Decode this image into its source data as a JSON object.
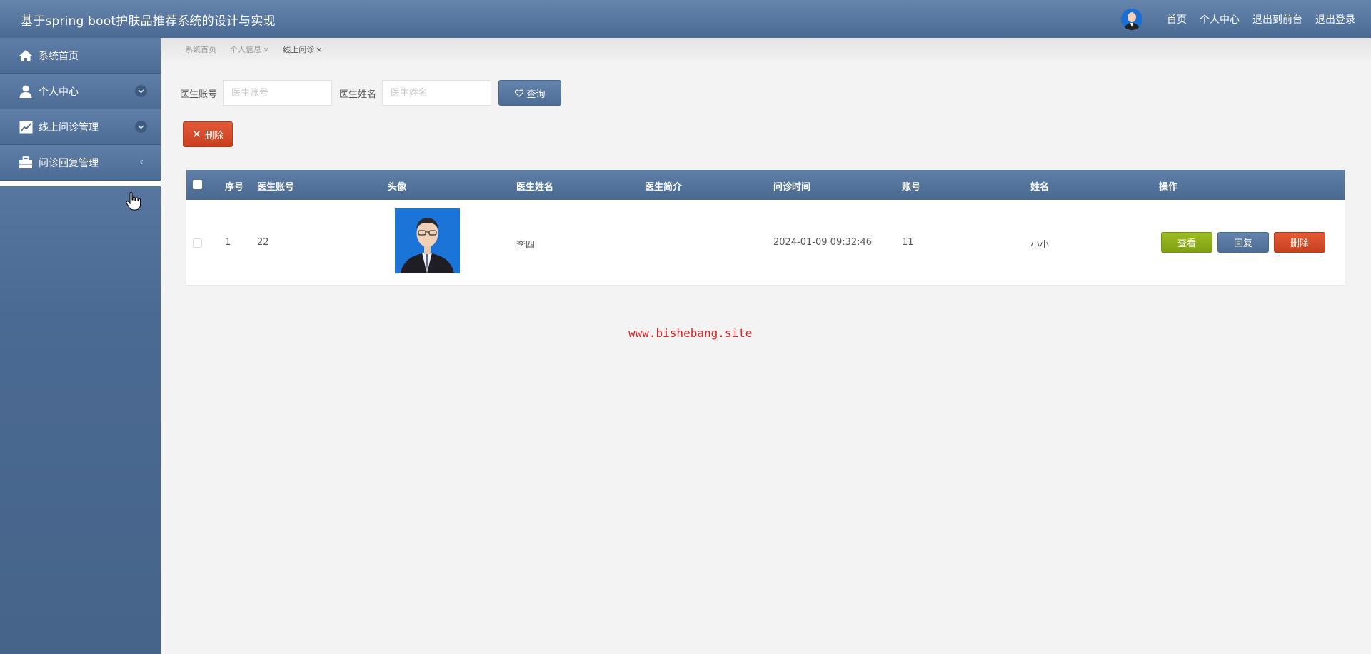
{
  "app": {
    "title": "基于spring boot护肤品推荐系统的设计与实现"
  },
  "header_nav": {
    "home": "首页",
    "profile": "个人中心",
    "to_front": "退出到前台",
    "logout": "退出登录"
  },
  "sidebar": {
    "items": [
      {
        "label": "系统首页",
        "icon": "home-icon"
      },
      {
        "label": "个人中心",
        "icon": "user-icon"
      },
      {
        "label": "线上问诊管理",
        "icon": "chart-line-icon"
      },
      {
        "label": "问诊回复管理",
        "icon": "briefcase-icon"
      }
    ]
  },
  "breadcrumb": {
    "items": [
      {
        "label": "系统首页",
        "closable": false
      },
      {
        "label": "个人信息",
        "closable": true
      },
      {
        "label": "线上问诊",
        "closable": true
      }
    ],
    "close_glyph": "×"
  },
  "search": {
    "doctor_account_label": "医生账号",
    "doctor_account_placeholder": "医生账号",
    "doctor_name_label": "医生姓名",
    "doctor_name_placeholder": "医生姓名",
    "query_label": "查询"
  },
  "actions": {
    "delete_label": "删除"
  },
  "table": {
    "columns": [
      "序号",
      "医生账号",
      "头像",
      "医生姓名",
      "医生简介",
      "问诊时间",
      "账号",
      "姓名",
      "操作"
    ],
    "rows": [
      {
        "index": "1",
        "doctor_account": "22",
        "doctor_name": "李四",
        "doctor_intro": "",
        "consult_time": "2024-01-09 09:32:46",
        "account": "11",
        "name": "小小",
        "view_label": "查看",
        "reply_label": "回复",
        "delete_label": "删除"
      }
    ]
  },
  "watermark": "www.bishebang.site",
  "colors": {
    "header": "#5a7aa3",
    "sidebar": "#4f6e97",
    "danger": "#d44a28",
    "success": "#8aaa18",
    "primary": "#5778a1"
  }
}
